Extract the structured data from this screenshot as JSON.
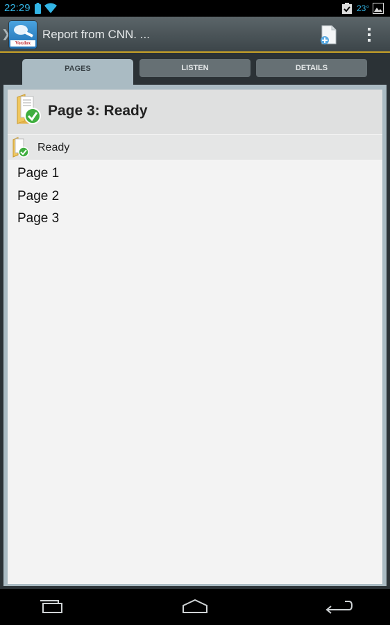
{
  "status_bar": {
    "time": "22:29",
    "temperature": "23°",
    "icons": [
      "battery-icon",
      "wifi-icon",
      "clipboard-check-icon",
      "image-icon"
    ],
    "accent": "#33b5e5"
  },
  "action_bar": {
    "app_icon_label": "Voxdox",
    "title": "Report from CNN. ...",
    "actions": [
      "add-document-icon",
      "overflow-menu-icon"
    ]
  },
  "tabs": [
    {
      "label": "PAGES",
      "active": true
    },
    {
      "label": "LISTEN",
      "active": false
    },
    {
      "label": "DETAILS",
      "active": false
    }
  ],
  "main": {
    "header_title": "Page 3: Ready",
    "status_label": "Ready",
    "pages": [
      "Page 1",
      "Page 2",
      "Page 3"
    ]
  },
  "nav_bar": {
    "buttons": [
      "recent-apps-icon",
      "home-icon",
      "back-icon"
    ]
  }
}
